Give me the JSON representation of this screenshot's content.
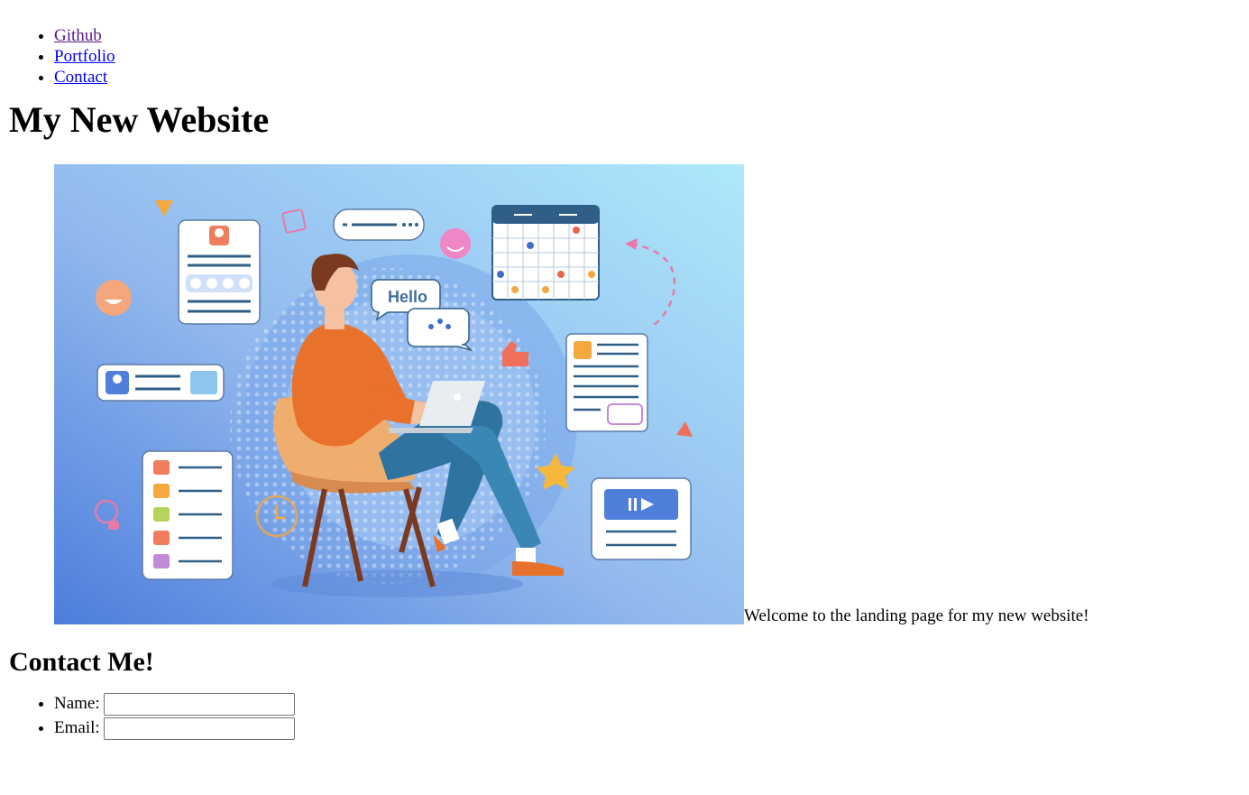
{
  "nav": {
    "items": [
      {
        "label": "Github"
      },
      {
        "label": "Portfolio"
      },
      {
        "label": "Contact"
      }
    ]
  },
  "header": {
    "title": "My New Website"
  },
  "hero": {
    "image_description_icon": "person-with-laptop-illustration",
    "bubble_text": "Hello",
    "welcome_text": "Welcome to the landing page for my new website!",
    "gradient_start": "#4f7fdb",
    "gradient_end": "#a8e6fb"
  },
  "contact": {
    "heading": "Contact Me!",
    "name_label": "Name:",
    "email_label": "Email:",
    "name_value": "",
    "email_value": ""
  },
  "colors": {
    "link": "#0000ee",
    "link_visited": "#551a8b"
  }
}
